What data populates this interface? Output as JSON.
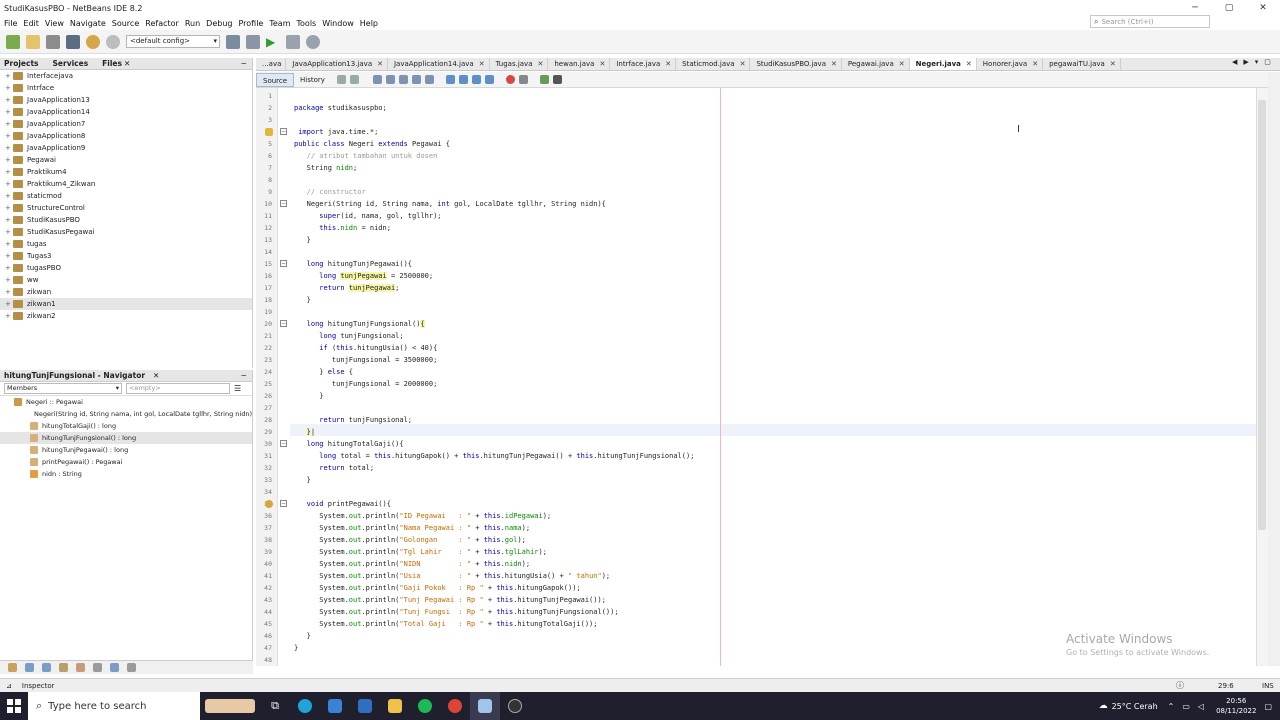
{
  "window": {
    "title": "StudiKasusPBO - NetBeans IDE 8.2",
    "search_placeholder": "Search (Ctrl+I)"
  },
  "menu": [
    "File",
    "Edit",
    "View",
    "Navigate",
    "Source",
    "Refactor",
    "Run",
    "Debug",
    "Profile",
    "Team",
    "Tools",
    "Window",
    "Help"
  ],
  "toolbar": {
    "config": "<default config>"
  },
  "projects_panel": {
    "tabs": [
      "Projects",
      "Services",
      "Files"
    ],
    "items": [
      "Interfacejava",
      "Intrface",
      "JavaApplication13",
      "JavaApplication14",
      "JavaApplication7",
      "JavaApplication8",
      "JavaApplication9",
      "Pegawai",
      "Praktikum4",
      "Praktikum4_Zikwan",
      "staticmod",
      "StructureControl",
      "StudiKasusPBO",
      "StudiKasusPegawai",
      "tugas",
      "Tugas3",
      "tugasPBO",
      "ww",
      "zikwan",
      "zikwan1",
      "zikwan2"
    ]
  },
  "navigator": {
    "title": "hitungTunjFungsional - Navigator",
    "members_label": "Members",
    "filter_placeholder": "<empty>",
    "items": [
      "Negeri :: Pegawai",
      "Negeri(String id, String nama, int gol, LocalDate tgllhr, String nidn)",
      "hitungTotalGaji() : long",
      "hitungTunjFungsional() : long",
      "hitungTunjPegawai() : long",
      "printPegawai() : Pegawai",
      "nidn : String"
    ]
  },
  "editor": {
    "tabs": [
      "...ava",
      "JavaApplication13.java",
      "JavaApplication14.java",
      "Tugas.java",
      "hewan.java",
      "Intrface.java",
      "Staticmod.java",
      "StudiKasusPBO.java",
      "Pegawai.java",
      "Negeri.java",
      "Honorer.java",
      "pegawaiTU.java"
    ],
    "active_tab": "Negeri.java",
    "source_label": "Source",
    "history_label": "History",
    "line_numbers": [
      "1",
      "2",
      "3",
      "4",
      "5",
      "6",
      "7",
      "8",
      "9",
      "10",
      "11",
      "12",
      "13",
      "14",
      "15",
      "16",
      "17",
      "18",
      "19",
      "20",
      "21",
      "22",
      "23",
      "24",
      "25",
      "26",
      "27",
      "28",
      "29",
      "30",
      "31",
      "32",
      "33",
      "34",
      "35",
      "36",
      "37",
      "38",
      "39",
      "40",
      "41",
      "42",
      "43",
      "44",
      "45",
      "46",
      "47",
      "48"
    ]
  },
  "status": {
    "inspector": "Inspector",
    "position": "29:6",
    "mode": "INS"
  },
  "watermark": {
    "title": "Activate Windows",
    "subtitle": "Go to Settings to activate Windows."
  },
  "taskbar": {
    "search_placeholder": "Type here to search",
    "weather": "25°C Cerah",
    "time": "20:56",
    "date": "08/11/2022"
  }
}
